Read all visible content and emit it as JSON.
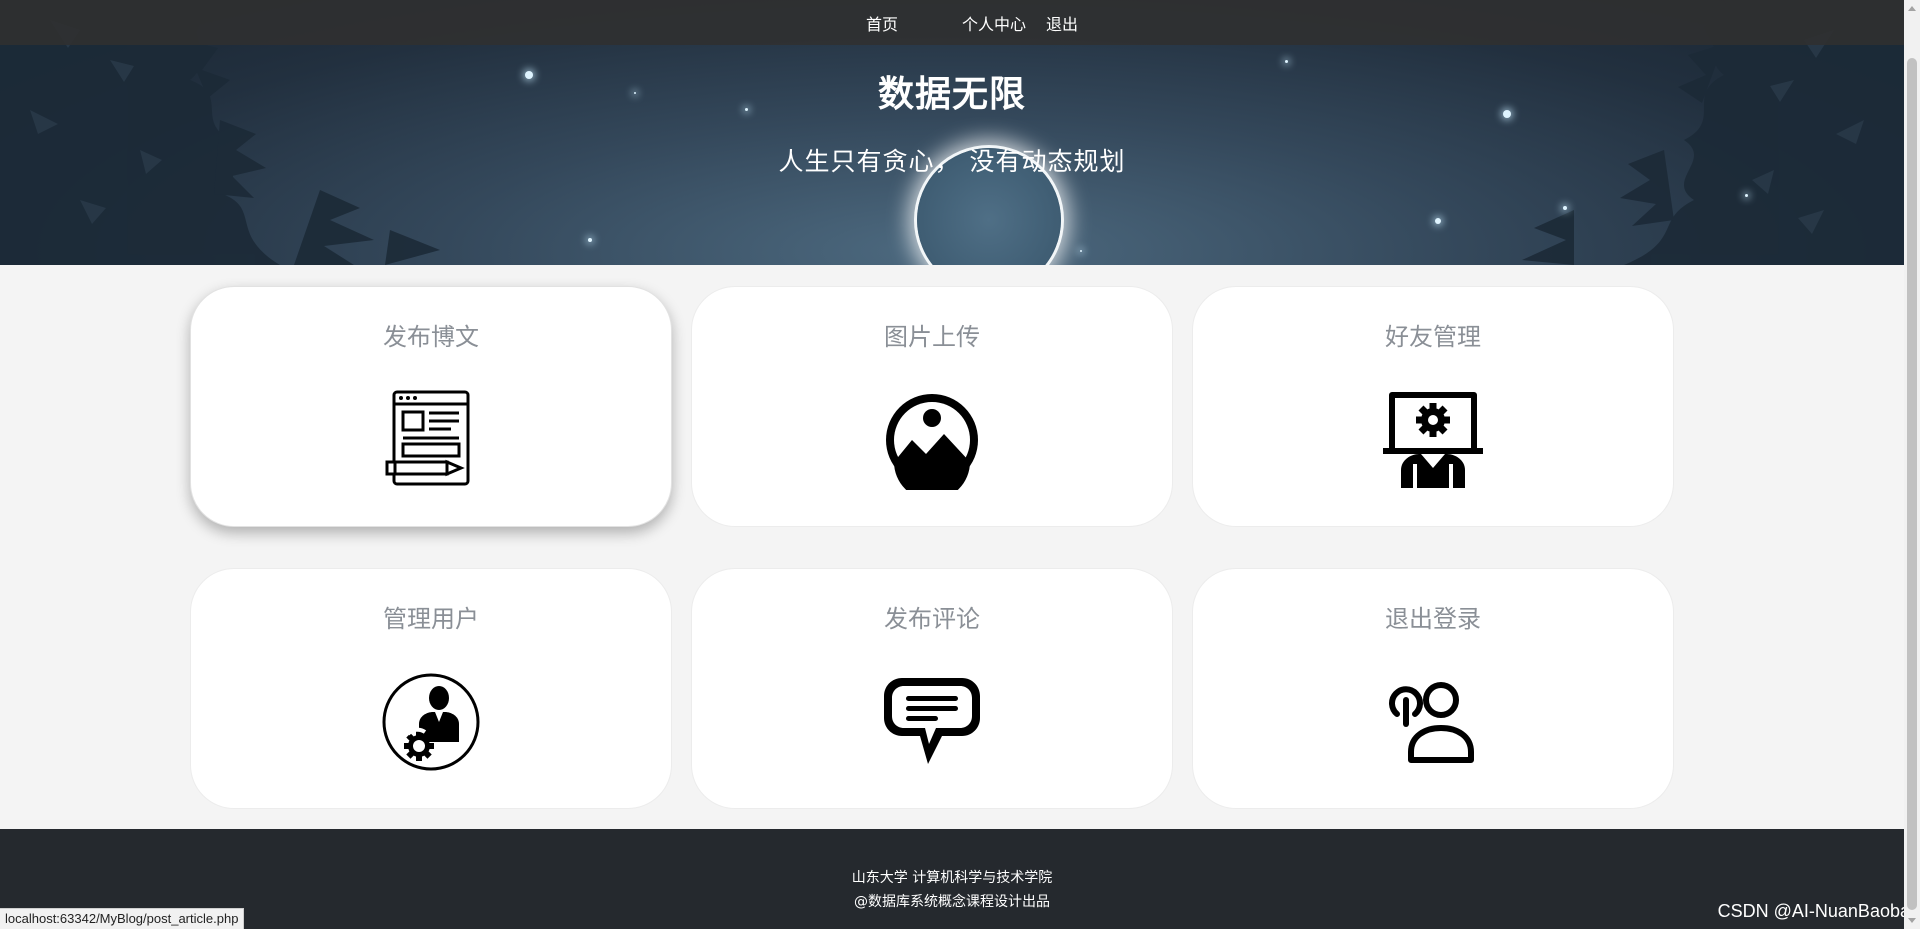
{
  "nav": {
    "home": "首页",
    "profile": "个人中心",
    "logout": "退出"
  },
  "hero": {
    "title": "数据无限",
    "subtitle": "人生只有贪心， 没有动态规划"
  },
  "cards": [
    {
      "title": "发布博文",
      "icon": "article-edit-icon"
    },
    {
      "title": "图片上传",
      "icon": "image-icon"
    },
    {
      "title": "好友管理",
      "icon": "friend-manage-icon"
    },
    {
      "title": "管理用户",
      "icon": "user-settings-icon"
    },
    {
      "title": "发布评论",
      "icon": "comment-icon"
    },
    {
      "title": "退出登录",
      "icon": "logout-user-icon"
    }
  ],
  "footer": {
    "line1": "山东大学 计算机科学与技术学院",
    "line2": "@数据库系统概念课程设计出品"
  },
  "watermark": "CSDN @AI-NuanBaobao",
  "status_url": "localhost:63342/MyBlog/post_article.php",
  "colors": {
    "navbar": "#303030",
    "footer": "#25292e",
    "card_title": "#8a8f96",
    "page_background": "#f4f4f4"
  }
}
